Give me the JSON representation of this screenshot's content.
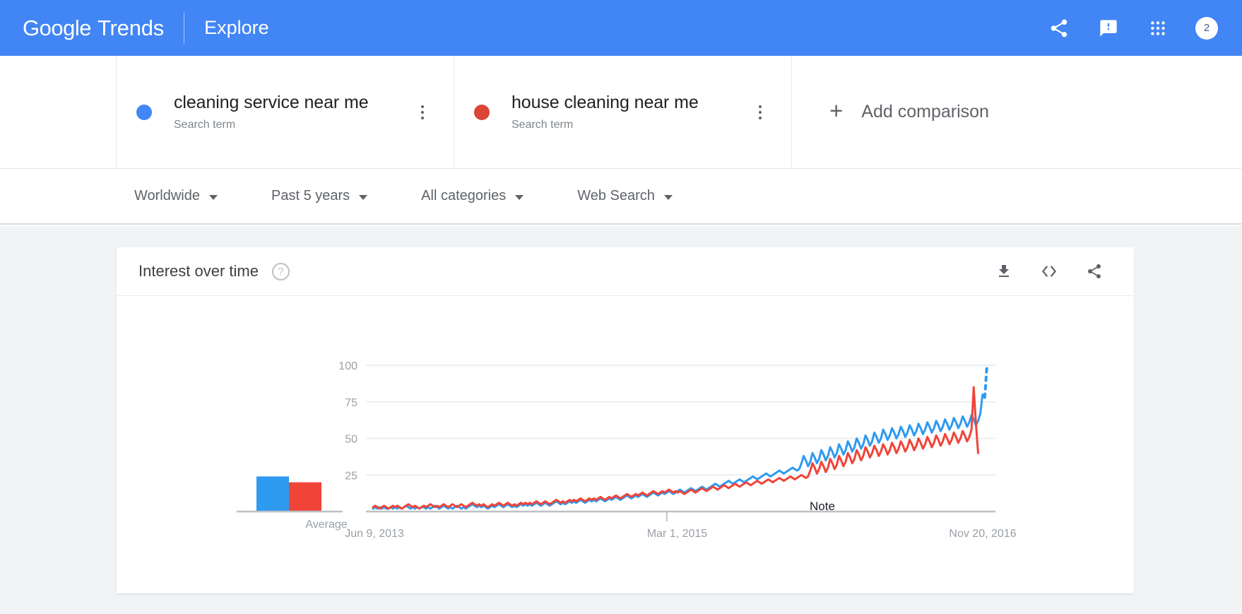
{
  "appbar": {
    "brand_google": "Google",
    "brand_product": "Trends",
    "explore": "Explore",
    "icons": [
      "share-icon",
      "feedback-icon",
      "apps-grid-icon"
    ],
    "avatar_text": "2",
    "background_color": "#4285F4"
  },
  "terms": [
    {
      "name": "cleaning service near me",
      "type_label": "Search term",
      "color": "#4285F4"
    },
    {
      "name": "house cleaning near me",
      "type_label": "Search term",
      "color": "#DB4437"
    }
  ],
  "add_comparison": {
    "label": "Add comparison",
    "plus": "+"
  },
  "filters": [
    {
      "label": "Worldwide"
    },
    {
      "label": "Past 5 years"
    },
    {
      "label": "All categories"
    },
    {
      "label": "Web Search"
    }
  ],
  "chart_card": {
    "title": "Interest over time",
    "help_glyph": "?",
    "tools": [
      "download-icon",
      "embed-code-icon",
      "share-icon"
    ]
  },
  "chart_data": {
    "type": "line",
    "title": "Interest over time",
    "xlabel": "",
    "ylabel": "",
    "ylim": [
      0,
      100
    ],
    "yticks": [
      25,
      50,
      75,
      100
    ],
    "xticks": [
      "Jun 9, 2013",
      "Mar 1, 2015",
      "Nov 20, 2016"
    ],
    "grid": true,
    "legend_position": "top-cards",
    "annotations": [
      {
        "text": "Note",
        "x_index": 133
      }
    ],
    "average_bars": {
      "label": "Average",
      "values": [
        24,
        20
      ],
      "colors": [
        "#2E9AF0",
        "#F04438"
      ]
    },
    "partial_last_point": true,
    "series": [
      {
        "name": "cleaning service near me",
        "color": "#2E9AF0",
        "values": [
          2,
          3,
          2,
          3,
          2,
          3,
          2,
          2,
          3,
          2,
          3,
          2,
          3,
          2,
          3,
          4,
          3,
          2,
          3,
          2,
          3,
          2,
          3,
          3,
          2,
          3,
          2,
          3,
          4,
          3,
          2,
          3,
          4,
          3,
          2,
          3,
          2,
          3,
          4,
          3,
          2,
          3,
          2,
          3,
          4,
          5,
          4,
          3,
          4,
          3,
          4,
          3,
          2,
          3,
          4,
          3,
          4,
          5,
          4,
          3,
          4,
          5,
          4,
          3,
          4,
          3,
          4,
          5,
          4,
          5,
          4,
          5,
          4,
          5,
          6,
          5,
          4,
          5,
          6,
          5,
          4,
          5,
          6,
          7,
          6,
          5,
          6,
          5,
          6,
          7,
          6,
          7,
          6,
          7,
          8,
          7,
          6,
          7,
          8,
          7,
          8,
          7,
          8,
          9,
          8,
          7,
          8,
          9,
          8,
          9,
          10,
          9,
          8,
          9,
          10,
          11,
          10,
          9,
          10,
          11,
          10,
          11,
          12,
          11,
          10,
          11,
          12,
          13,
          12,
          11,
          12,
          13,
          12,
          13,
          14,
          13,
          12,
          13,
          14,
          15,
          14,
          13,
          14,
          15,
          16,
          15,
          14,
          15,
          16,
          17,
          16,
          15,
          16,
          17,
          18,
          19,
          18,
          17,
          18,
          19,
          20,
          21,
          20,
          19,
          20,
          21,
          22,
          21,
          20,
          21,
          22,
          23,
          24,
          23,
          22,
          23,
          24,
          25,
          26,
          25,
          24,
          25,
          26,
          27,
          28,
          27,
          26,
          27,
          28,
          29,
          30,
          29,
          28,
          29,
          33,
          38,
          35,
          31,
          34,
          40,
          37,
          33,
          36,
          42,
          39,
          35,
          38,
          44,
          41,
          37,
          40,
          46,
          43,
          39,
          42,
          48,
          45,
          41,
          44,
          50,
          47,
          43,
          46,
          52,
          49,
          45,
          48,
          54,
          51,
          47,
          50,
          56,
          53,
          49,
          52,
          57,
          54,
          50,
          53,
          58,
          55,
          51,
          54,
          59,
          56,
          52,
          55,
          60,
          57,
          53,
          56,
          61,
          58,
          54,
          57,
          62,
          59,
          55,
          58,
          63,
          60,
          56,
          59,
          64,
          61,
          57,
          60,
          65,
          62,
          58,
          61,
          66,
          63,
          59,
          62,
          67,
          80,
          78,
          100
        ]
      },
      {
        "name": "house cleaning near me",
        "color": "#F04438",
        "values": [
          3,
          4,
          3,
          2,
          3,
          4,
          3,
          2,
          3,
          4,
          3,
          4,
          3,
          2,
          3,
          4,
          5,
          4,
          3,
          4,
          3,
          2,
          3,
          4,
          3,
          4,
          5,
          4,
          3,
          4,
          3,
          4,
          5,
          4,
          3,
          4,
          5,
          4,
          3,
          4,
          5,
          4,
          3,
          4,
          5,
          6,
          5,
          4,
          5,
          4,
          5,
          4,
          3,
          4,
          5,
          4,
          5,
          6,
          5,
          4,
          5,
          6,
          5,
          4,
          5,
          4,
          5,
          6,
          5,
          6,
          5,
          6,
          5,
          6,
          7,
          6,
          5,
          6,
          7,
          6,
          5,
          6,
          7,
          8,
          7,
          6,
          7,
          6,
          7,
          8,
          7,
          8,
          7,
          8,
          9,
          8,
          7,
          8,
          9,
          8,
          9,
          8,
          9,
          10,
          9,
          8,
          9,
          10,
          9,
          10,
          11,
          10,
          9,
          10,
          11,
          12,
          11,
          10,
          11,
          12,
          11,
          12,
          13,
          12,
          11,
          12,
          13,
          14,
          13,
          12,
          13,
          14,
          13,
          14,
          15,
          14,
          13,
          14,
          13,
          14,
          13,
          12,
          13,
          14,
          15,
          14,
          13,
          14,
          15,
          16,
          15,
          14,
          15,
          16,
          17,
          16,
          15,
          16,
          17,
          18,
          17,
          16,
          17,
          18,
          19,
          18,
          17,
          18,
          19,
          20,
          19,
          18,
          19,
          20,
          21,
          20,
          19,
          20,
          21,
          22,
          21,
          20,
          21,
          22,
          23,
          22,
          21,
          22,
          23,
          24,
          23,
          22,
          23,
          24,
          25,
          24,
          23,
          24,
          28,
          33,
          30,
          26,
          29,
          34,
          31,
          27,
          30,
          36,
          33,
          29,
          32,
          38,
          35,
          31,
          34,
          40,
          37,
          33,
          36,
          42,
          39,
          35,
          38,
          44,
          41,
          37,
          40,
          45,
          42,
          38,
          41,
          46,
          43,
          39,
          42,
          47,
          44,
          40,
          43,
          48,
          45,
          41,
          44,
          49,
          46,
          42,
          45,
          50,
          47,
          43,
          46,
          51,
          48,
          44,
          47,
          52,
          49,
          45,
          48,
          53,
          50,
          46,
          49,
          54,
          51,
          47,
          50,
          55,
          52,
          48,
          51,
          56,
          85,
          60,
          40
        ]
      }
    ]
  }
}
